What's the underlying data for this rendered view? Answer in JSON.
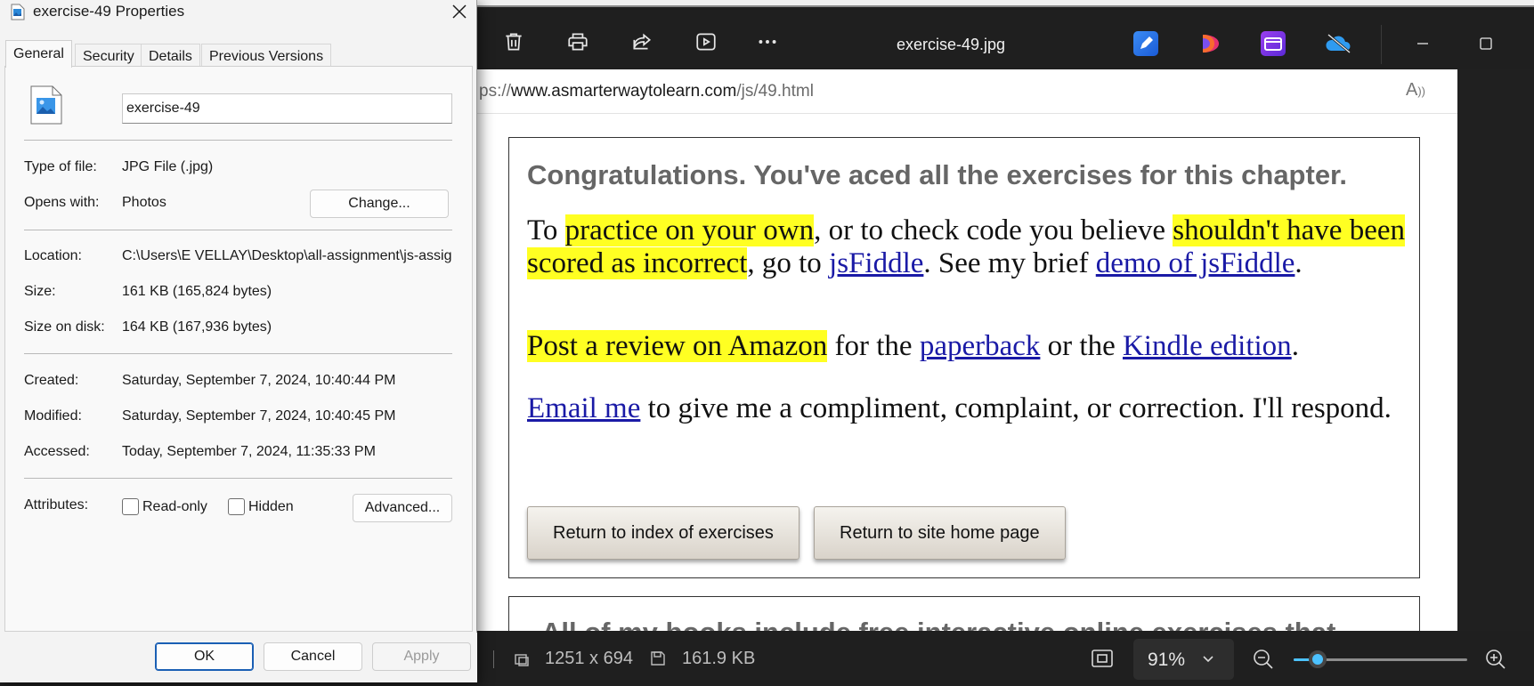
{
  "viewer": {
    "title": "exercise-49.jpg",
    "toolbar": {
      "delete_icon": "trash-icon",
      "print_icon": "printer-icon",
      "share_icon": "share-icon",
      "slideshow_icon": "play-icon",
      "more_icon": "more-icon"
    },
    "apps": [
      "photos-editor-icon",
      "designer-icon",
      "clipchamp-icon",
      "onedrive-icon"
    ],
    "status": {
      "dimensions": "1251 x 694",
      "file_size": "161.9 KB",
      "zoom": "91%",
      "zoom_fraction": 0.14
    }
  },
  "webpage": {
    "url_prefix": "ps://",
    "url_domain": "www.asmarterwaytolearn.com",
    "url_path": "/js/49.html",
    "heading": "Congratulations. You've aced all the exercises for this chapter.",
    "p1": {
      "hl1": "practice on your own",
      "t1": "To ",
      "t2": ", or to check code you believe ",
      "hl2": "shouldn't have been scored as incorrect",
      "t3": ", go to ",
      "link1": "jsFiddle",
      "t4": ". See my brief ",
      "link2": "demo of jsFiddle",
      "t5": "."
    },
    "p2": {
      "hl": "Post a review on Amazon",
      "t1": " for the ",
      "link1": "paperback",
      "t2": " or the ",
      "link2": "Kindle edition",
      "t3": "."
    },
    "p3": {
      "link": "Email me",
      "t1": " to give me a compliment, complaint, or correction. I'll respond."
    },
    "btn_index": "Return to index of exercises",
    "btn_home": "Return to site home page",
    "books_partial": "All of my books include free interactive online exercises that"
  },
  "dialog": {
    "title": "exercise-49 Properties",
    "tabs": [
      "General",
      "Security",
      "Details",
      "Previous Versions"
    ],
    "file_name": "exercise-49",
    "rows": {
      "type_label": "Type of file:",
      "type_value": "JPG File (.jpg)",
      "opens_label": "Opens with:",
      "opens_value": "Photos",
      "change_button": "Change...",
      "location_label": "Location:",
      "location_value": "C:\\Users\\E VELLAY\\Desktop\\all-assignment\\js-assig",
      "size_label": "Size:",
      "size_value": "161 KB (165,824 bytes)",
      "disk_label": "Size on disk:",
      "disk_value": "164 KB (167,936 bytes)",
      "created_label": "Created:",
      "created_value": "Saturday, September 7, 2024, 10:40:44 PM",
      "modified_label": "Modified:",
      "modified_value": "Saturday, September 7, 2024, 10:40:45 PM",
      "accessed_label": "Accessed:",
      "accessed_value": "Today, September 7, 2024, 11:35:33 PM",
      "attributes_label": "Attributes:",
      "readonly_label": "Read-only",
      "hidden_label": "Hidden",
      "advanced_button": "Advanced..."
    },
    "buttons": {
      "ok": "OK",
      "cancel": "Cancel",
      "apply": "Apply"
    }
  }
}
